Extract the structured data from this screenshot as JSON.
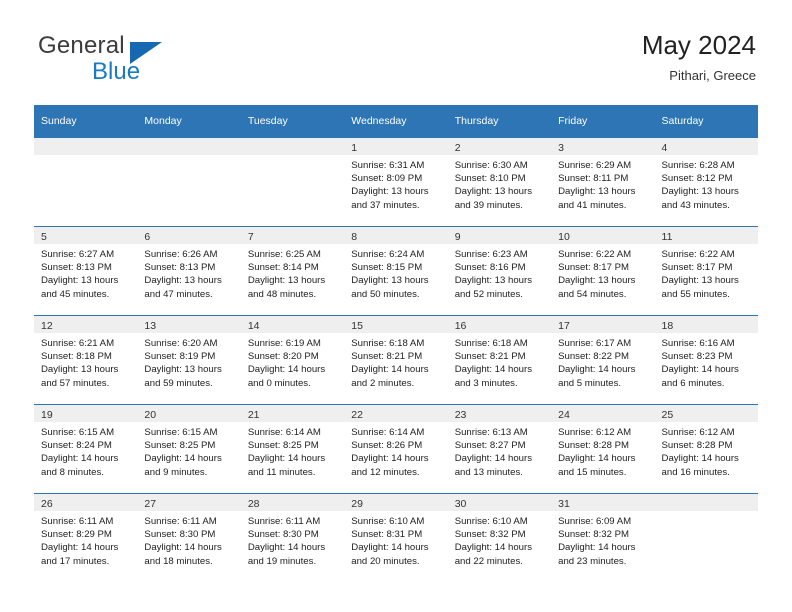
{
  "brand": {
    "name_top": "General",
    "name_bottom": "Blue",
    "triangle_color": "#1669b0",
    "blue_color": "#1a7ac4"
  },
  "header": {
    "title": "May 2024",
    "subtitle": "Pithari, Greece"
  },
  "theme": {
    "header_bg": "#2e75b6",
    "header_text": "#ffffff",
    "daynum_bg": "#efefef",
    "cell_bg": "#ffffff",
    "border": "#2e75b6"
  },
  "weekdays": [
    "Sunday",
    "Monday",
    "Tuesday",
    "Wednesday",
    "Thursday",
    "Friday",
    "Saturday"
  ],
  "labels": {
    "sunrise_prefix": "Sunrise:",
    "sunset_prefix": "Sunset:",
    "daylight_prefix": "Daylight:"
  },
  "weeks": [
    [
      {
        "day": "",
        "sunrise": "",
        "sunset": "",
        "daylight": ""
      },
      {
        "day": "",
        "sunrise": "",
        "sunset": "",
        "daylight": ""
      },
      {
        "day": "",
        "sunrise": "",
        "sunset": "",
        "daylight": ""
      },
      {
        "day": "1",
        "sunrise": "Sunrise: 6:31 AM",
        "sunset": "Sunset: 8:09 PM",
        "daylight": "Daylight: 13 hours and 37 minutes."
      },
      {
        "day": "2",
        "sunrise": "Sunrise: 6:30 AM",
        "sunset": "Sunset: 8:10 PM",
        "daylight": "Daylight: 13 hours and 39 minutes."
      },
      {
        "day": "3",
        "sunrise": "Sunrise: 6:29 AM",
        "sunset": "Sunset: 8:11 PM",
        "daylight": "Daylight: 13 hours and 41 minutes."
      },
      {
        "day": "4",
        "sunrise": "Sunrise: 6:28 AM",
        "sunset": "Sunset: 8:12 PM",
        "daylight": "Daylight: 13 hours and 43 minutes."
      }
    ],
    [
      {
        "day": "5",
        "sunrise": "Sunrise: 6:27 AM",
        "sunset": "Sunset: 8:13 PM",
        "daylight": "Daylight: 13 hours and 45 minutes."
      },
      {
        "day": "6",
        "sunrise": "Sunrise: 6:26 AM",
        "sunset": "Sunset: 8:13 PM",
        "daylight": "Daylight: 13 hours and 47 minutes."
      },
      {
        "day": "7",
        "sunrise": "Sunrise: 6:25 AM",
        "sunset": "Sunset: 8:14 PM",
        "daylight": "Daylight: 13 hours and 48 minutes."
      },
      {
        "day": "8",
        "sunrise": "Sunrise: 6:24 AM",
        "sunset": "Sunset: 8:15 PM",
        "daylight": "Daylight: 13 hours and 50 minutes."
      },
      {
        "day": "9",
        "sunrise": "Sunrise: 6:23 AM",
        "sunset": "Sunset: 8:16 PM",
        "daylight": "Daylight: 13 hours and 52 minutes."
      },
      {
        "day": "10",
        "sunrise": "Sunrise: 6:22 AM",
        "sunset": "Sunset: 8:17 PM",
        "daylight": "Daylight: 13 hours and 54 minutes."
      },
      {
        "day": "11",
        "sunrise": "Sunrise: 6:22 AM",
        "sunset": "Sunset: 8:17 PM",
        "daylight": "Daylight: 13 hours and 55 minutes."
      }
    ],
    [
      {
        "day": "12",
        "sunrise": "Sunrise: 6:21 AM",
        "sunset": "Sunset: 8:18 PM",
        "daylight": "Daylight: 13 hours and 57 minutes."
      },
      {
        "day": "13",
        "sunrise": "Sunrise: 6:20 AM",
        "sunset": "Sunset: 8:19 PM",
        "daylight": "Daylight: 13 hours and 59 minutes."
      },
      {
        "day": "14",
        "sunrise": "Sunrise: 6:19 AM",
        "sunset": "Sunset: 8:20 PM",
        "daylight": "Daylight: 14 hours and 0 minutes."
      },
      {
        "day": "15",
        "sunrise": "Sunrise: 6:18 AM",
        "sunset": "Sunset: 8:21 PM",
        "daylight": "Daylight: 14 hours and 2 minutes."
      },
      {
        "day": "16",
        "sunrise": "Sunrise: 6:18 AM",
        "sunset": "Sunset: 8:21 PM",
        "daylight": "Daylight: 14 hours and 3 minutes."
      },
      {
        "day": "17",
        "sunrise": "Sunrise: 6:17 AM",
        "sunset": "Sunset: 8:22 PM",
        "daylight": "Daylight: 14 hours and 5 minutes."
      },
      {
        "day": "18",
        "sunrise": "Sunrise: 6:16 AM",
        "sunset": "Sunset: 8:23 PM",
        "daylight": "Daylight: 14 hours and 6 minutes."
      }
    ],
    [
      {
        "day": "19",
        "sunrise": "Sunrise: 6:15 AM",
        "sunset": "Sunset: 8:24 PM",
        "daylight": "Daylight: 14 hours and 8 minutes."
      },
      {
        "day": "20",
        "sunrise": "Sunrise: 6:15 AM",
        "sunset": "Sunset: 8:25 PM",
        "daylight": "Daylight: 14 hours and 9 minutes."
      },
      {
        "day": "21",
        "sunrise": "Sunrise: 6:14 AM",
        "sunset": "Sunset: 8:25 PM",
        "daylight": "Daylight: 14 hours and 11 minutes."
      },
      {
        "day": "22",
        "sunrise": "Sunrise: 6:14 AM",
        "sunset": "Sunset: 8:26 PM",
        "daylight": "Daylight: 14 hours and 12 minutes."
      },
      {
        "day": "23",
        "sunrise": "Sunrise: 6:13 AM",
        "sunset": "Sunset: 8:27 PM",
        "daylight": "Daylight: 14 hours and 13 minutes."
      },
      {
        "day": "24",
        "sunrise": "Sunrise: 6:12 AM",
        "sunset": "Sunset: 8:28 PM",
        "daylight": "Daylight: 14 hours and 15 minutes."
      },
      {
        "day": "25",
        "sunrise": "Sunrise: 6:12 AM",
        "sunset": "Sunset: 8:28 PM",
        "daylight": "Daylight: 14 hours and 16 minutes."
      }
    ],
    [
      {
        "day": "26",
        "sunrise": "Sunrise: 6:11 AM",
        "sunset": "Sunset: 8:29 PM",
        "daylight": "Daylight: 14 hours and 17 minutes."
      },
      {
        "day": "27",
        "sunrise": "Sunrise: 6:11 AM",
        "sunset": "Sunset: 8:30 PM",
        "daylight": "Daylight: 14 hours and 18 minutes."
      },
      {
        "day": "28",
        "sunrise": "Sunrise: 6:11 AM",
        "sunset": "Sunset: 8:30 PM",
        "daylight": "Daylight: 14 hours and 19 minutes."
      },
      {
        "day": "29",
        "sunrise": "Sunrise: 6:10 AM",
        "sunset": "Sunset: 8:31 PM",
        "daylight": "Daylight: 14 hours and 20 minutes."
      },
      {
        "day": "30",
        "sunrise": "Sunrise: 6:10 AM",
        "sunset": "Sunset: 8:32 PM",
        "daylight": "Daylight: 14 hours and 22 minutes."
      },
      {
        "day": "31",
        "sunrise": "Sunrise: 6:09 AM",
        "sunset": "Sunset: 8:32 PM",
        "daylight": "Daylight: 14 hours and 23 minutes."
      },
      {
        "day": "",
        "sunrise": "",
        "sunset": "",
        "daylight": ""
      }
    ]
  ]
}
